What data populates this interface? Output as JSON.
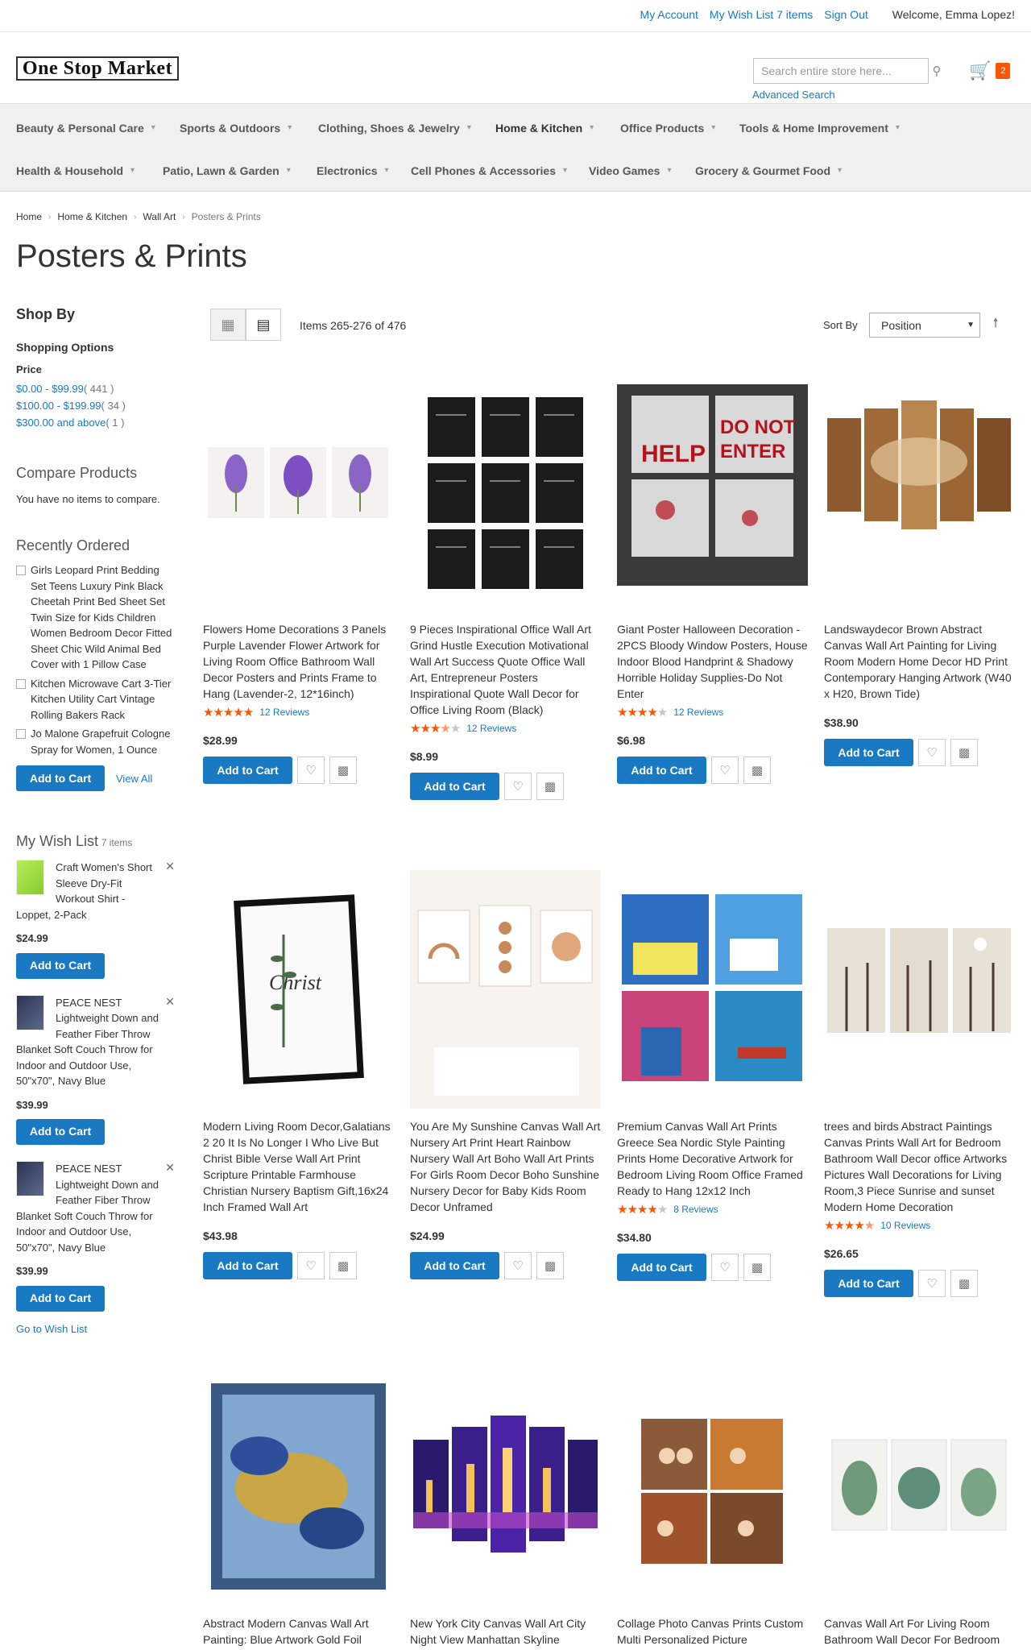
{
  "header": {
    "links": [
      "My Account",
      "My Wish List 7 items",
      "Sign Out"
    ],
    "welcome": "Welcome, Emma Lopez!",
    "logo": "One Stop Market",
    "search_placeholder": "Search entire store here...",
    "advanced_search": "Advanced Search",
    "cart_count": "2"
  },
  "nav": {
    "row1": [
      "Beauty & Personal Care",
      "Sports & Outdoors",
      "Clothing, Shoes & Jewelry",
      "Home & Kitchen",
      "Office Products",
      "Tools & Home Improvement"
    ],
    "row2": [
      "Health & Household",
      "Patio, Lawn & Garden",
      "Electronics",
      "Cell Phones & Accessories",
      "Video Games",
      "Grocery & Gourmet Food"
    ]
  },
  "breadcrumb": [
    "Home",
    "Home & Kitchen",
    "Wall Art",
    "Posters & Prints"
  ],
  "page_title": "Posters & Prints",
  "sidebar": {
    "shop_by": "Shop By",
    "shopping_options": "Shopping Options",
    "price_label": "Price",
    "price_filters": [
      {
        "range": "$0.00 - $99.99",
        "count": "( 441 )"
      },
      {
        "range": "$100.00 - $199.99",
        "count": "( 34 )"
      },
      {
        "range": "$300.00 and above",
        "count": "( 1 )"
      }
    ],
    "compare_title": "Compare Products",
    "compare_empty": "You have no items to compare.",
    "recently_ordered_title": "Recently Ordered",
    "recently_ordered": [
      "Girls Leopard Print Bedding Set Teens Luxury Pink Black Cheetah Print Bed Sheet Set Twin Size for Kids Children Women Bedroom Decor Fitted Sheet Chic Wild Animal Bed Cover with 1 Pillow Case",
      "Kitchen Microwave Cart 3-Tier Kitchen Utility Cart Vintage Rolling Bakers Rack",
      "Jo Malone Grapefruit Cologne Spray for Women, 1 Ounce"
    ],
    "add_to_cart": "Add to Cart",
    "view_all": "View All",
    "wishlist_title": "My Wish List",
    "wishlist_count": "7 items",
    "wishlist": [
      {
        "name": "Craft Women's Short Sleeve Dry-Fit Workout Shirt - Loppet, 2-Pack",
        "price": "$24.99"
      },
      {
        "name": "PEACE NEST Lightweight Down and Feather Fiber Throw Blanket Soft Couch Throw for Indoor and Outdoor Use, 50\"x70\", Navy Blue",
        "price": "$39.99"
      },
      {
        "name": "PEACE NEST Lightweight Down and Feather Fiber Throw Blanket Soft Couch Throw for Indoor and Outdoor Use, 50\"x70\", Navy Blue",
        "price": "$39.99"
      }
    ],
    "go_to_wishlist": "Go to Wish List"
  },
  "toolbar": {
    "amount": "Items 265-276 of 476",
    "sort_label": "Sort By",
    "sort_value": "Position"
  },
  "products": [
    {
      "name": "Flowers Home Decorations 3 Panels Purple Lavender Flower Artwork for Living Room Office Bathroom Wall Decor Posters and Prints Frame to Hang (Lavender-2, 12*16inch)",
      "rating": 100,
      "reviews": "12  Reviews",
      "price": "$28.99"
    },
    {
      "name": "9 Pieces Inspirational Office Wall Art Grind Hustle Execution Motivational Wall Art Success Quote Office Wall Art, Entrepreneur Posters Inspirational Quote Wall Decor for Office Living Room (Black)",
      "rating": 70,
      "reviews": "12  Reviews",
      "price": "$8.99"
    },
    {
      "name": "Giant Poster Halloween Decoration - 2PCS Bloody Window Posters, House Indoor Blood Handprint & Shadowy Horrible Holiday Supplies-Do Not Enter",
      "rating": 80,
      "reviews": "12  Reviews",
      "price": "$6.98"
    },
    {
      "name": "Landswaydecor Brown Abstract Canvas Wall Art Painting for Living Room Modern Home Decor HD Print Contemporary Hanging Artwork (W40 x H20, Brown Tide)",
      "rating": null,
      "reviews": "",
      "price": "$38.90"
    },
    {
      "name": "Modern Living Room Decor,Galatians 2 20 It Is No Longer I Who Live But Christ Bible Verse Wall Art Print Scripture Printable Farmhouse Christian Nursery Baptism Gift,16x24 Inch Framed Wall Art",
      "rating": null,
      "reviews": "",
      "price": "$43.98"
    },
    {
      "name": "You Are My Sunshine Canvas Wall Art Nursery Art Print Heart Rainbow Nursery Wall Art Boho Wall Art Prints For Girls Room Decor Boho Sunshine Nursery Decor for Baby Kids Room Decor Unframed",
      "rating": null,
      "reviews": "",
      "price": "$24.99"
    },
    {
      "name": "Premium Canvas Wall Art Prints Greece Sea Nordic Style Painting Prints Home Decorative Artwork for Bedroom Living Room Office Framed Ready to Hang 12x12 Inch",
      "rating": 80,
      "reviews": "8  Reviews",
      "price": "$34.80"
    },
    {
      "name": "trees and birds Abstract Paintings Canvas Prints Wall Art for Bedroom Bathroom Wall Decor office Artworks Pictures Wall Decorations for Living Room,3 Piece Sunrise and sunset Modern Home Decoration",
      "rating": 90,
      "reviews": "10  Reviews",
      "price": "$26.65"
    },
    {
      "name": "Abstract Modern Canvas Wall Art Painting: Blue Artwork Gold Foil",
      "rating": null,
      "reviews": "",
      "price": ""
    },
    {
      "name": "New York City Canvas Wall Art City Night View Manhattan Skyline",
      "rating": null,
      "reviews": "",
      "price": ""
    },
    {
      "name": "Collage Photo Canvas Prints Custom Multi Personalized Picture",
      "rating": null,
      "reviews": "",
      "price": ""
    },
    {
      "name": "Canvas Wall Art For Living Room Bathroom Wall Decor For Bedroom",
      "rating": null,
      "reviews": "",
      "price": ""
    }
  ],
  "labels": {
    "add_to_cart": "Add to Cart"
  },
  "colors": {
    "accent": "#1979c3",
    "cart_badge": "#ff5501",
    "star": "#ff5501"
  }
}
